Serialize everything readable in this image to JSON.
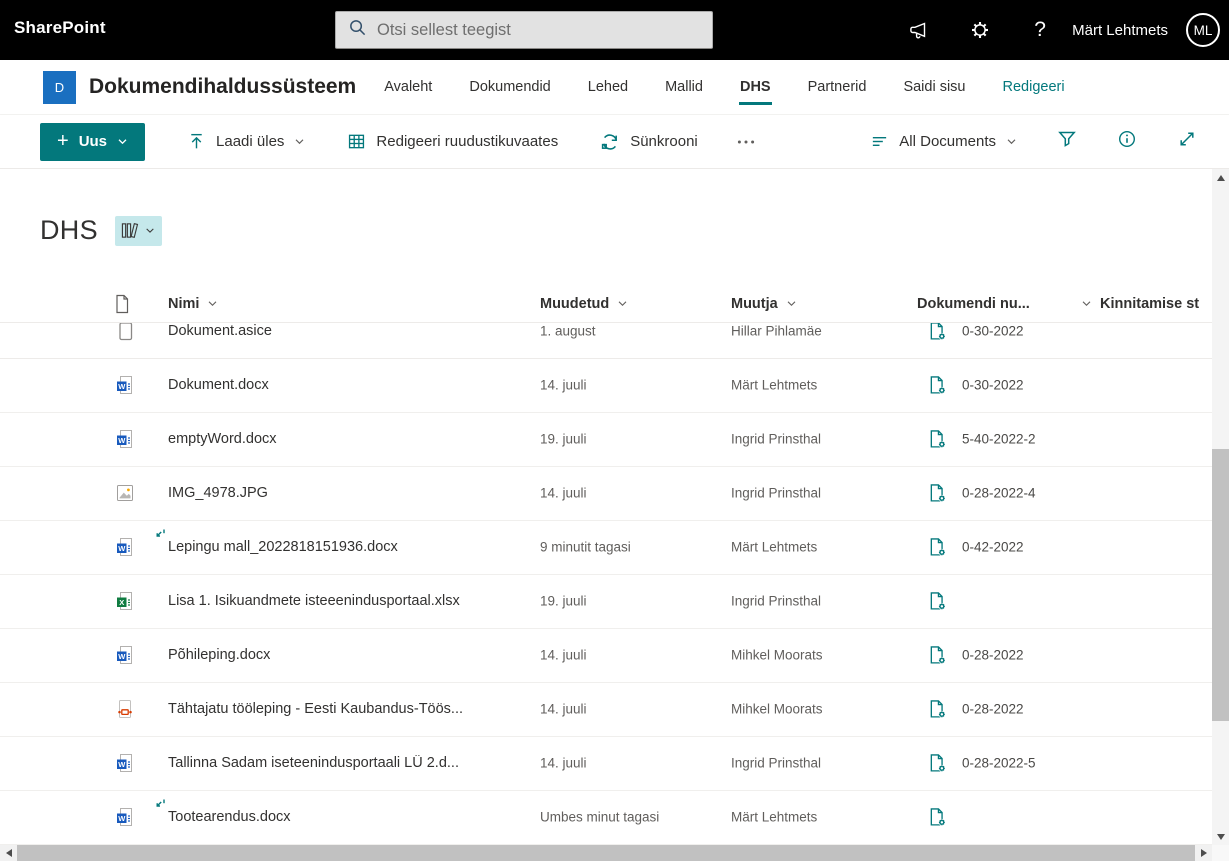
{
  "topbar": {
    "brand": "SharePoint",
    "search_placeholder": "Otsi sellest teegist",
    "user_name": "Märt Lehtmets",
    "avatar_initials": "ML"
  },
  "site": {
    "logo_letter": "D",
    "title": "Dokumendihaldussüsteem",
    "nav": [
      {
        "label": "Avaleht"
      },
      {
        "label": "Dokumendid"
      },
      {
        "label": "Lehed"
      },
      {
        "label": "Mallid"
      },
      {
        "label": "DHS",
        "active": true
      },
      {
        "label": "Partnerid"
      },
      {
        "label": "Saidi sisu"
      },
      {
        "label": "Redigeeri",
        "accent": true
      }
    ]
  },
  "toolbar": {
    "new_label": "Uus",
    "upload_label": "Laadi üles",
    "grid_edit_label": "Redigeeri ruudustikuvaates",
    "sync_label": "Sünkrooni",
    "view_label": "All Documents"
  },
  "page": {
    "title": "DHS"
  },
  "table": {
    "headers": {
      "name": "Nimi",
      "modified": "Muudetud",
      "modified_by": "Muutja",
      "doc_number": "Dokumendi nu...",
      "approval": "Kinnitamise st"
    },
    "rows": [
      {
        "icon": "generic",
        "name": "Dokument.asice",
        "modified": "1. august",
        "modified_by": "Hillar Pihlamäe",
        "doc_number": "0-30-2022",
        "has_doc_icon": true,
        "is_new": false,
        "clipped": true
      },
      {
        "icon": "word",
        "name": "Dokument.docx",
        "modified": "14. juuli",
        "modified_by": "Märt Lehtmets",
        "doc_number": "0-30-2022",
        "has_doc_icon": true,
        "is_new": false,
        "clipped": false
      },
      {
        "icon": "word",
        "name": "emptyWord.docx",
        "modified": "19. juuli",
        "modified_by": "Ingrid Prinsthal",
        "doc_number": "5-40-2022-2",
        "has_doc_icon": true,
        "is_new": false,
        "clipped": false
      },
      {
        "icon": "image",
        "name": "IMG_4978.JPG",
        "modified": "14. juuli",
        "modified_by": "Ingrid Prinsthal",
        "doc_number": "0-28-2022-4",
        "has_doc_icon": true,
        "is_new": false,
        "clipped": false
      },
      {
        "icon": "word",
        "name": "Lepingu mall_2022818151936.docx",
        "modified": "9 minutit tagasi",
        "modified_by": "Märt Lehtmets",
        "doc_number": "0-42-2022",
        "has_doc_icon": true,
        "is_new": true,
        "clipped": false
      },
      {
        "icon": "excel",
        "name": "Lisa 1. Isikuandmete isteeenindusportaal.xlsx",
        "modified": "19. juuli",
        "modified_by": "Ingrid Prinsthal",
        "doc_number": "",
        "has_doc_icon": true,
        "is_new": false,
        "clipped": false
      },
      {
        "icon": "word",
        "name": "Põhileping.docx",
        "modified": "14. juuli",
        "modified_by": "Mihkel Moorats",
        "doc_number": "0-28-2022",
        "has_doc_icon": true,
        "is_new": false,
        "clipped": false
      },
      {
        "icon": "asice",
        "name": "Tähtajatu tööleping - Eesti Kaubandus-Töös...",
        "modified": "14. juuli",
        "modified_by": "Mihkel Moorats",
        "doc_number": "0-28-2022",
        "has_doc_icon": true,
        "is_new": false,
        "clipped": false
      },
      {
        "icon": "word",
        "name": "Tallinna Sadam iseteenindusportaali LÜ 2.d...",
        "modified": "14. juuli",
        "modified_by": "Ingrid Prinsthal",
        "doc_number": "0-28-2022-5",
        "has_doc_icon": true,
        "is_new": false,
        "clipped": false
      },
      {
        "icon": "word",
        "name": "Tootearendus.docx",
        "modified": "Umbes minut tagasi",
        "modified_by": "Märt Lehtmets",
        "doc_number": "",
        "has_doc_icon": true,
        "is_new": true,
        "clipped": false
      }
    ]
  },
  "colors": {
    "accent": "#03787c",
    "logo_blue": "#1a6fc0",
    "badge_teal": "#c5e8eb",
    "word_blue": "#185abd",
    "excel_green": "#107c41",
    "asice_red": "#d83b01"
  }
}
